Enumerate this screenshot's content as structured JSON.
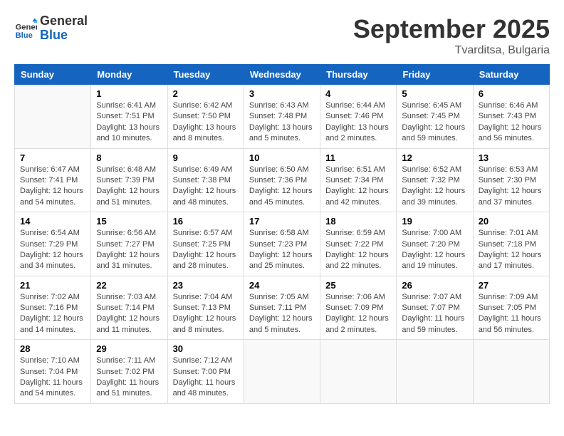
{
  "logo": {
    "general": "General",
    "blue": "Blue"
  },
  "title": "September 2025",
  "location": "Tvarditsa, Bulgaria",
  "days_of_week": [
    "Sunday",
    "Monday",
    "Tuesday",
    "Wednesday",
    "Thursday",
    "Friday",
    "Saturday"
  ],
  "weeks": [
    [
      {
        "day": "",
        "info": ""
      },
      {
        "day": "1",
        "info": "Sunrise: 6:41 AM\nSunset: 7:51 PM\nDaylight: 13 hours\nand 10 minutes."
      },
      {
        "day": "2",
        "info": "Sunrise: 6:42 AM\nSunset: 7:50 PM\nDaylight: 13 hours\nand 8 minutes."
      },
      {
        "day": "3",
        "info": "Sunrise: 6:43 AM\nSunset: 7:48 PM\nDaylight: 13 hours\nand 5 minutes."
      },
      {
        "day": "4",
        "info": "Sunrise: 6:44 AM\nSunset: 7:46 PM\nDaylight: 13 hours\nand 2 minutes."
      },
      {
        "day": "5",
        "info": "Sunrise: 6:45 AM\nSunset: 7:45 PM\nDaylight: 12 hours\nand 59 minutes."
      },
      {
        "day": "6",
        "info": "Sunrise: 6:46 AM\nSunset: 7:43 PM\nDaylight: 12 hours\nand 56 minutes."
      }
    ],
    [
      {
        "day": "7",
        "info": "Sunrise: 6:47 AM\nSunset: 7:41 PM\nDaylight: 12 hours\nand 54 minutes."
      },
      {
        "day": "8",
        "info": "Sunrise: 6:48 AM\nSunset: 7:39 PM\nDaylight: 12 hours\nand 51 minutes."
      },
      {
        "day": "9",
        "info": "Sunrise: 6:49 AM\nSunset: 7:38 PM\nDaylight: 12 hours\nand 48 minutes."
      },
      {
        "day": "10",
        "info": "Sunrise: 6:50 AM\nSunset: 7:36 PM\nDaylight: 12 hours\nand 45 minutes."
      },
      {
        "day": "11",
        "info": "Sunrise: 6:51 AM\nSunset: 7:34 PM\nDaylight: 12 hours\nand 42 minutes."
      },
      {
        "day": "12",
        "info": "Sunrise: 6:52 AM\nSunset: 7:32 PM\nDaylight: 12 hours\nand 39 minutes."
      },
      {
        "day": "13",
        "info": "Sunrise: 6:53 AM\nSunset: 7:30 PM\nDaylight: 12 hours\nand 37 minutes."
      }
    ],
    [
      {
        "day": "14",
        "info": "Sunrise: 6:54 AM\nSunset: 7:29 PM\nDaylight: 12 hours\nand 34 minutes."
      },
      {
        "day": "15",
        "info": "Sunrise: 6:56 AM\nSunset: 7:27 PM\nDaylight: 12 hours\nand 31 minutes."
      },
      {
        "day": "16",
        "info": "Sunrise: 6:57 AM\nSunset: 7:25 PM\nDaylight: 12 hours\nand 28 minutes."
      },
      {
        "day": "17",
        "info": "Sunrise: 6:58 AM\nSunset: 7:23 PM\nDaylight: 12 hours\nand 25 minutes."
      },
      {
        "day": "18",
        "info": "Sunrise: 6:59 AM\nSunset: 7:22 PM\nDaylight: 12 hours\nand 22 minutes."
      },
      {
        "day": "19",
        "info": "Sunrise: 7:00 AM\nSunset: 7:20 PM\nDaylight: 12 hours\nand 19 minutes."
      },
      {
        "day": "20",
        "info": "Sunrise: 7:01 AM\nSunset: 7:18 PM\nDaylight: 12 hours\nand 17 minutes."
      }
    ],
    [
      {
        "day": "21",
        "info": "Sunrise: 7:02 AM\nSunset: 7:16 PM\nDaylight: 12 hours\nand 14 minutes."
      },
      {
        "day": "22",
        "info": "Sunrise: 7:03 AM\nSunset: 7:14 PM\nDaylight: 12 hours\nand 11 minutes."
      },
      {
        "day": "23",
        "info": "Sunrise: 7:04 AM\nSunset: 7:13 PM\nDaylight: 12 hours\nand 8 minutes."
      },
      {
        "day": "24",
        "info": "Sunrise: 7:05 AM\nSunset: 7:11 PM\nDaylight: 12 hours\nand 5 minutes."
      },
      {
        "day": "25",
        "info": "Sunrise: 7:06 AM\nSunset: 7:09 PM\nDaylight: 12 hours\nand 2 minutes."
      },
      {
        "day": "26",
        "info": "Sunrise: 7:07 AM\nSunset: 7:07 PM\nDaylight: 11 hours\nand 59 minutes."
      },
      {
        "day": "27",
        "info": "Sunrise: 7:09 AM\nSunset: 7:05 PM\nDaylight: 11 hours\nand 56 minutes."
      }
    ],
    [
      {
        "day": "28",
        "info": "Sunrise: 7:10 AM\nSunset: 7:04 PM\nDaylight: 11 hours\nand 54 minutes."
      },
      {
        "day": "29",
        "info": "Sunrise: 7:11 AM\nSunset: 7:02 PM\nDaylight: 11 hours\nand 51 minutes."
      },
      {
        "day": "30",
        "info": "Sunrise: 7:12 AM\nSunset: 7:00 PM\nDaylight: 11 hours\nand 48 minutes."
      },
      {
        "day": "",
        "info": ""
      },
      {
        "day": "",
        "info": ""
      },
      {
        "day": "",
        "info": ""
      },
      {
        "day": "",
        "info": ""
      }
    ]
  ]
}
